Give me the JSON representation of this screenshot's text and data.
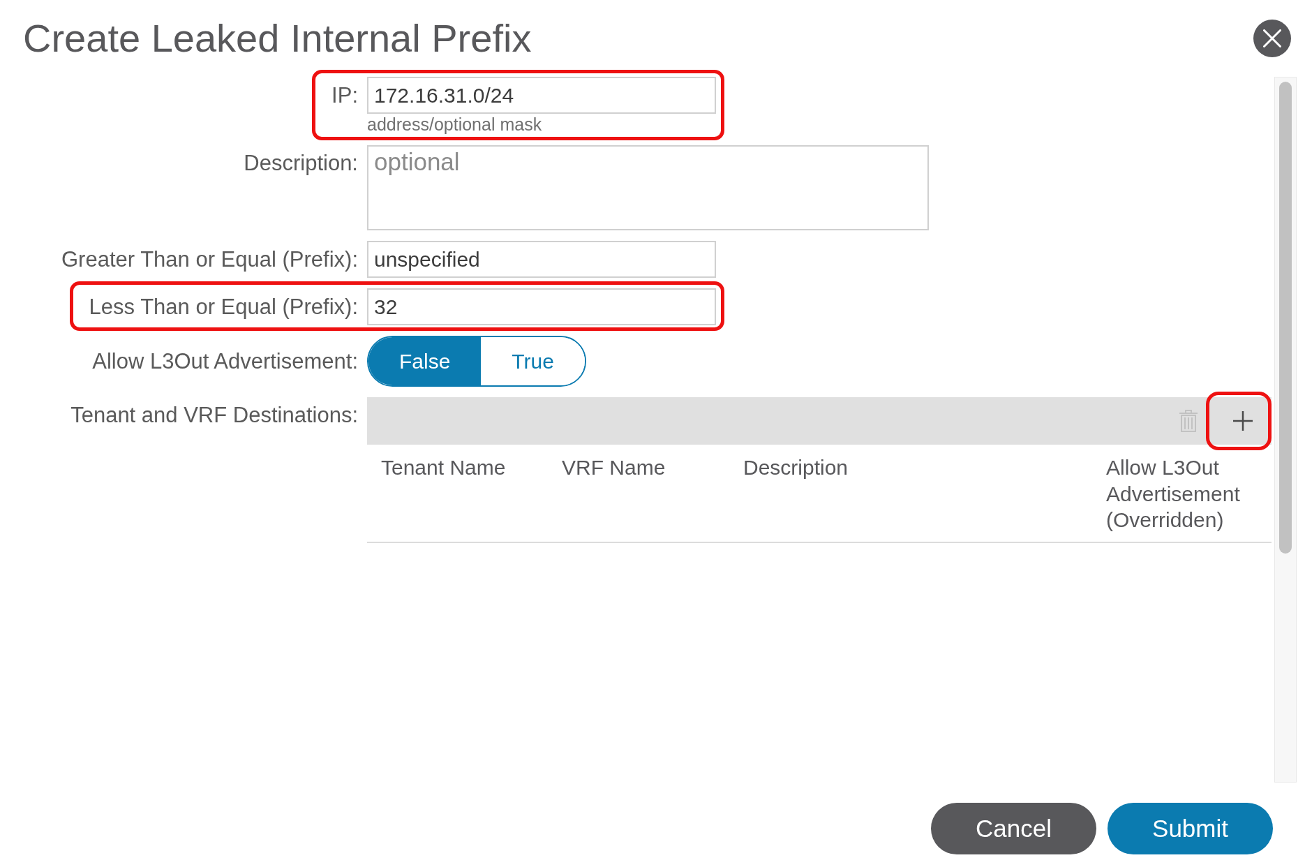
{
  "dialog": {
    "title": "Create Leaked Internal Prefix"
  },
  "fields": [
    {
      "kind": "input",
      "label": "IP:",
      "value": "172.16.31.0/24",
      "hint": "address/optional mask",
      "highlighted": true
    },
    {
      "kind": "textarea",
      "label": "Description:",
      "placeholder": "optional",
      "highlighted": false
    },
    {
      "kind": "input",
      "label": "Greater Than or Equal (Prefix):",
      "value": "unspecified",
      "highlighted": false
    },
    {
      "kind": "input",
      "label": "Less Than or Equal (Prefix):",
      "value": "32",
      "highlighted": true
    },
    {
      "kind": "toggle",
      "label": "Allow L3Out Advertisement:",
      "highlighted": false,
      "options": [
        {
          "label": "False",
          "selected": true
        },
        {
          "label": "True",
          "selected": false
        }
      ]
    },
    {
      "kind": "table",
      "label": "Tenant and VRF Destinations:",
      "highlighted": false,
      "toolbar": [
        {
          "kind": "delete",
          "disabled": true,
          "highlighted": false
        },
        {
          "kind": "add",
          "disabled": false,
          "highlighted": true
        }
      ],
      "columns": [
        "Tenant Name",
        "VRF Name",
        "Description",
        "Allow L3Out Advertisement (Overridden)"
      ]
    }
  ],
  "buttons": [
    {
      "kind": "secondary",
      "label": "Cancel"
    },
    {
      "kind": "primary",
      "label": "Submit"
    }
  ]
}
